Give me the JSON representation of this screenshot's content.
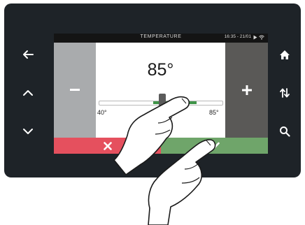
{
  "screen": {
    "title": "TEMPERATURE",
    "time": "16:35 - 21/01",
    "value": "85°",
    "min_label": "40°",
    "max_label": "85°",
    "slider_fraction": 0.62
  },
  "icons": {
    "left": [
      "arrow-left-icon",
      "chevron-up-icon",
      "chevron-down-icon"
    ],
    "right": [
      "home-icon",
      "sort-icon",
      "search-icon"
    ],
    "panels": [
      "minus-icon",
      "plus-icon",
      "close-icon",
      "check-icon"
    ]
  },
  "colors": {
    "device": "#1e2328",
    "minus_panel": "#a9abad",
    "plus_panel": "#5a5957",
    "cancel": "#e5505e",
    "confirm": "#6fa56a",
    "slider_fill": "#3f9448"
  }
}
